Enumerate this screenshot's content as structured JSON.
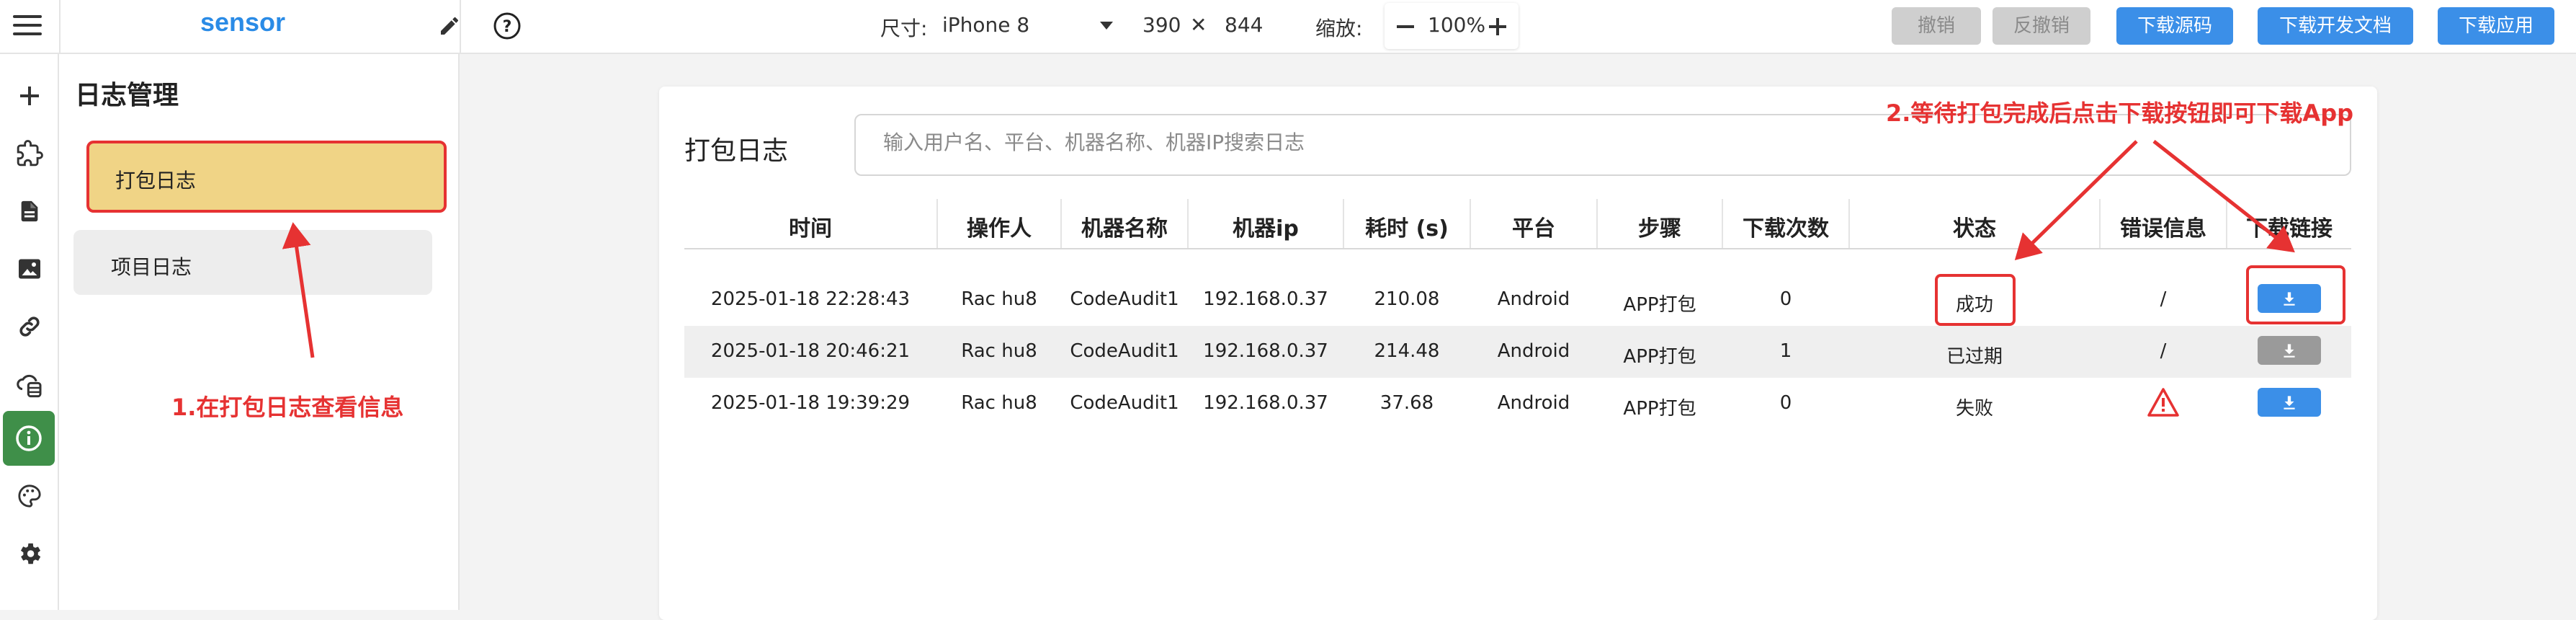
{
  "topbar": {
    "brand": "sensor",
    "size_label": "尺寸:",
    "device": "iPhone 8",
    "width": "390",
    "times": "✕",
    "height": "844",
    "zoom_label": "缩放:",
    "zoom_value": "100%",
    "buttons": {
      "undo": "撤销",
      "redo": "反撤销",
      "download_source": "下载源码",
      "download_docs": "下载开发文档",
      "download_app": "下载应用"
    }
  },
  "rail": {
    "items": [
      "plus-icon",
      "puzzle-icon",
      "document-icon",
      "image-icon",
      "link-icon",
      "cloud-db-icon",
      "info-icon",
      "palette-icon",
      "gear-icon"
    ],
    "active": "info-icon",
    "active_color": "#3f8f49"
  },
  "sidebar": {
    "title": "日志管理",
    "items": [
      {
        "label": "打包日志",
        "selected": true
      },
      {
        "label": "项目日志",
        "selected": false
      }
    ]
  },
  "main": {
    "title": "打包日志",
    "search_placeholder": "输入用户名、平台、机器名称、机器IP搜索日志",
    "columns": [
      "时间",
      "操作人",
      "机器名称",
      "机器ip",
      "耗时 (s)",
      "平台",
      "步骤",
      "下载次数",
      "状态",
      "错误信息",
      "下载链接"
    ],
    "rows": [
      {
        "time": "2025-01-18 22:28:43",
        "operator": "Rac hu8",
        "machine": "CodeAudit1",
        "ip": "192.168.0.37",
        "duration": "210.08",
        "platform": "Android",
        "step": "APP打包",
        "downloads": "0",
        "status": "成功",
        "error": "/",
        "download": "enabled"
      },
      {
        "time": "2025-01-18 20:46:21",
        "operator": "Rac hu8",
        "machine": "CodeAudit1",
        "ip": "192.168.0.37",
        "duration": "214.48",
        "platform": "Android",
        "step": "APP打包",
        "downloads": "1",
        "status": "已过期",
        "error": "/",
        "download": "disabled"
      },
      {
        "time": "2025-01-18 19:39:29",
        "operator": "Rac hu8",
        "machine": "CodeAudit1",
        "ip": "192.168.0.37",
        "duration": "37.68",
        "platform": "Android",
        "step": "APP打包",
        "downloads": "0",
        "status": "失败",
        "error": "warning-icon",
        "download": "enabled"
      }
    ]
  },
  "annotations": {
    "note1": "1.在打包日志查看信息",
    "note2": "2.等待打包完成后点击下载按钮即可下载App",
    "color": "#e63232"
  },
  "colors": {
    "brand": "#2a8be6",
    "primary_button": "#3b8fe8",
    "selected_item": "#f0d486"
  }
}
